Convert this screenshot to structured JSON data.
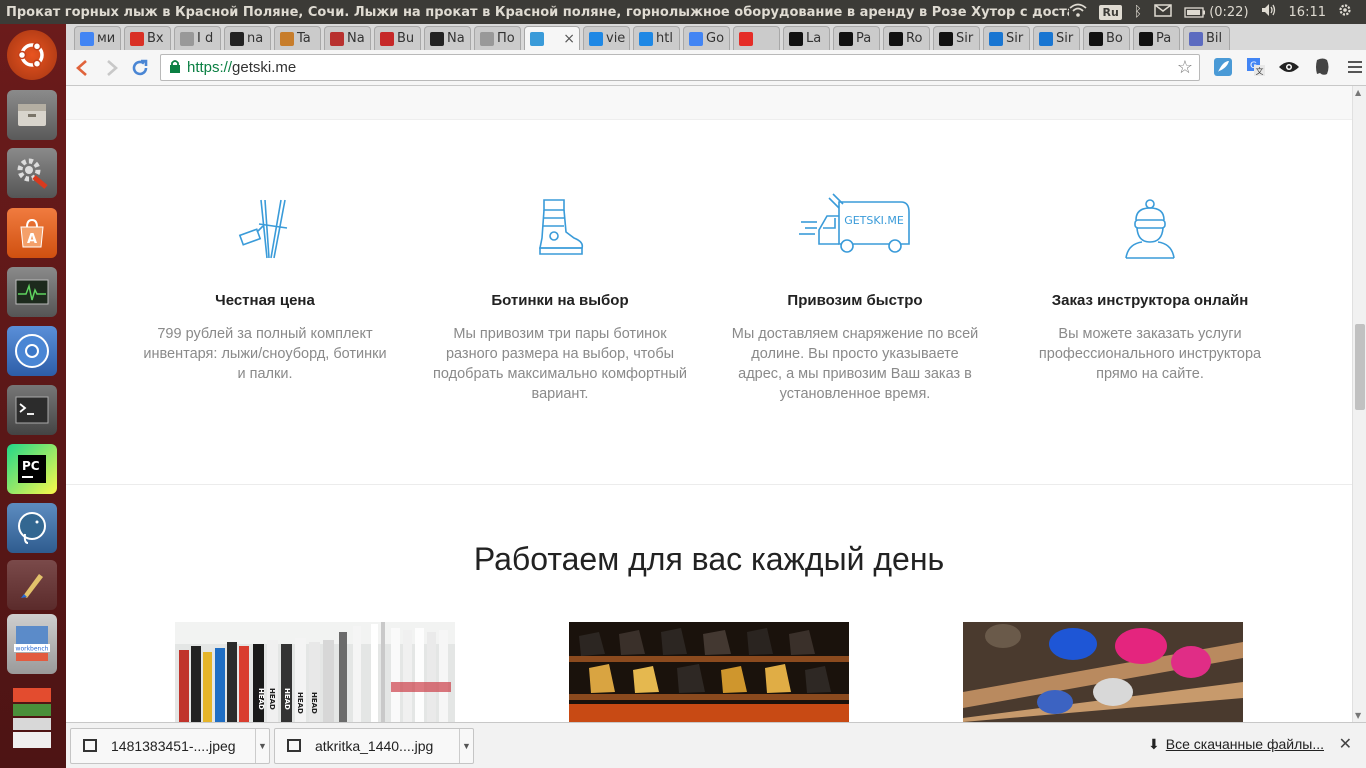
{
  "system": {
    "window_title": "Прокат горных лыж в Красной Поляне, Сочи. Лыжи на прокат в Красной поляне, горнолыжное оборудование в аренду в Розе Хутор с доставкой",
    "keyboard_layout": "Ru",
    "battery": "(0:22)",
    "clock": "16:11"
  },
  "tabs": [
    {
      "label": "ми",
      "icon": "google-icon",
      "color": "#4285f4"
    },
    {
      "label": "Вх",
      "icon": "gmail-icon",
      "color": "#d93025"
    },
    {
      "label": "I d",
      "icon": "page-icon",
      "color": "#999999"
    },
    {
      "label": "na",
      "icon": "github-icon",
      "color": "#222222"
    },
    {
      "label": "Ta",
      "icon": "bag-icon",
      "color": "#c77d2b"
    },
    {
      "label": "Na",
      "icon": "puzzle-icon",
      "color": "#b8312f"
    },
    {
      "label": "Bu",
      "icon": "ir-icon",
      "color": "#c62828"
    },
    {
      "label": "Na",
      "icon": "github-icon",
      "color": "#222222"
    },
    {
      "label": "По",
      "icon": "page-icon",
      "color": "#999999"
    },
    {
      "label": "",
      "icon": "getski-icon",
      "color": "#3a9bd9",
      "active": true
    },
    {
      "label": "vie",
      "icon": "gear-icon",
      "color": "#1e88e5"
    },
    {
      "label": "htl",
      "icon": "gear-icon",
      "color": "#1e88e5"
    },
    {
      "label": "Go",
      "icon": "translate-icon",
      "color": "#4285f4"
    },
    {
      "label": "",
      "icon": "youtube-icon",
      "color": "#e52d27"
    },
    {
      "label": "La",
      "icon": "w-icon",
      "color": "#111111"
    },
    {
      "label": "Pa",
      "icon": "w-icon",
      "color": "#111111"
    },
    {
      "label": "Ro",
      "icon": "w-icon",
      "color": "#111111"
    },
    {
      "label": "Sir",
      "icon": "w-icon",
      "color": "#111111"
    },
    {
      "label": "Sir",
      "icon": "drop-icon",
      "color": "#1976d2"
    },
    {
      "label": "Sir",
      "icon": "drop-icon",
      "color": "#1976d2"
    },
    {
      "label": "Bo",
      "icon": "w-icon",
      "color": "#111111"
    },
    {
      "label": "Pa",
      "icon": "w-icon",
      "color": "#111111"
    },
    {
      "label": "Bil",
      "icon": "bil-icon",
      "color": "#5c6bc0"
    }
  ],
  "address": {
    "scheme": "https://",
    "host": "getski.me"
  },
  "features": [
    {
      "title": "Честная цена",
      "text": "799 рублей за полный комплект инвентаря: лыжи/сноуборд, ботинки и палки.",
      "icon": "skis-price-tag-icon"
    },
    {
      "title": "Ботинки на выбор",
      "text": "Мы привозим три пары ботинок разного размера на выбор, чтобы подобрать максимально комфортный вариант.",
      "icon": "ski-boot-icon"
    },
    {
      "title": "Привозим быстро",
      "text": "Мы доставляем снаряжение по всей долине. Вы просто указываете адрес, а мы привозим Ваш заказ в установленное время.",
      "icon": "delivery-van-icon",
      "van_label": "GETSKI.ME"
    },
    {
      "title": "Заказ инструктора онлайн",
      "text": "Вы можете заказать услуги профессионального инструктора прямо на сайте.",
      "icon": "instructor-icon"
    }
  ],
  "section": {
    "title": "Работаем для вас каждый день"
  },
  "photos": [
    {
      "name": "skis-rack-photo",
      "brand": "HEAD"
    },
    {
      "name": "boots-shelf-photo"
    },
    {
      "name": "helmets-shelf-photo"
    }
  ],
  "downloads": {
    "items": [
      {
        "filename": "1481383451-....jpeg"
      },
      {
        "filename": "atkritka_1440....jpg"
      }
    ],
    "show_all": "Все скачанные файлы..."
  },
  "colors": {
    "accent": "#3a9bd9",
    "ssl_green": "#0b8043",
    "launcher": "#5c1616"
  }
}
